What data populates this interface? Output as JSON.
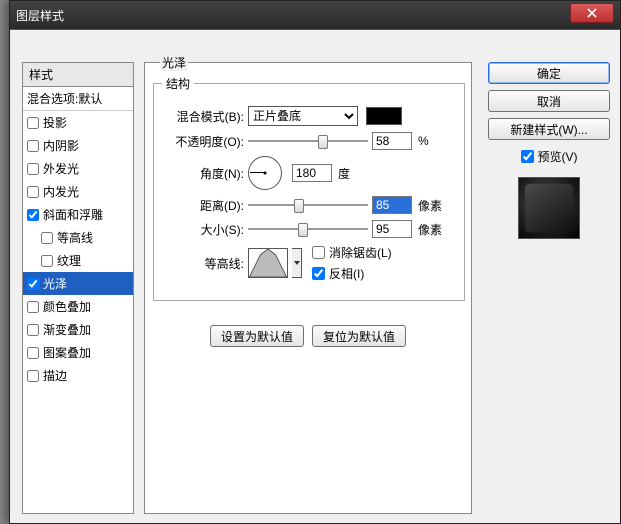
{
  "dialog": {
    "title": "图层样式"
  },
  "stylesHeader": "样式",
  "blendDefault": "混合选项:默认",
  "styleItems": [
    {
      "label": "投影",
      "checked": false
    },
    {
      "label": "内阴影",
      "checked": false
    },
    {
      "label": "外发光",
      "checked": false
    },
    {
      "label": "内发光",
      "checked": false
    },
    {
      "label": "斜面和浮雕",
      "checked": true
    },
    {
      "label": "等高线",
      "checked": false,
      "indent": true
    },
    {
      "label": "纹理",
      "checked": false,
      "indent": true
    },
    {
      "label": "光泽",
      "checked": true,
      "selected": true
    },
    {
      "label": "颜色叠加",
      "checked": false
    },
    {
      "label": "渐变叠加",
      "checked": false
    },
    {
      "label": "图案叠加",
      "checked": false
    },
    {
      "label": "描边",
      "checked": false
    }
  ],
  "main": {
    "groupTitle": "光泽",
    "structure": "结构",
    "blendModeLabel": "混合模式(B):",
    "blendModeValue": "正片叠底",
    "opacityLabel": "不透明度(O):",
    "opacityValue": "58",
    "opacityUnit": "%",
    "angleLabel": "角度(N):",
    "angleValue": "180",
    "angleUnit": "度",
    "distanceLabel": "距离(D):",
    "distanceValue": "85",
    "distanceUnit": "像素",
    "sizeLabel": "大小(S):",
    "sizeValue": "95",
    "sizeUnit": "像素",
    "contourLabel": "等高线:",
    "antialiasLabel": "消除锯齿(L)",
    "antialiasChecked": false,
    "invertLabel": "反相(I)",
    "invertChecked": true,
    "resetDefault": "设置为默认值",
    "restoreDefault": "复位为默认值"
  },
  "right": {
    "ok": "确定",
    "cancel": "取消",
    "newStyle": "新建样式(W)...",
    "previewLabel": "预览(V)",
    "previewChecked": true
  }
}
